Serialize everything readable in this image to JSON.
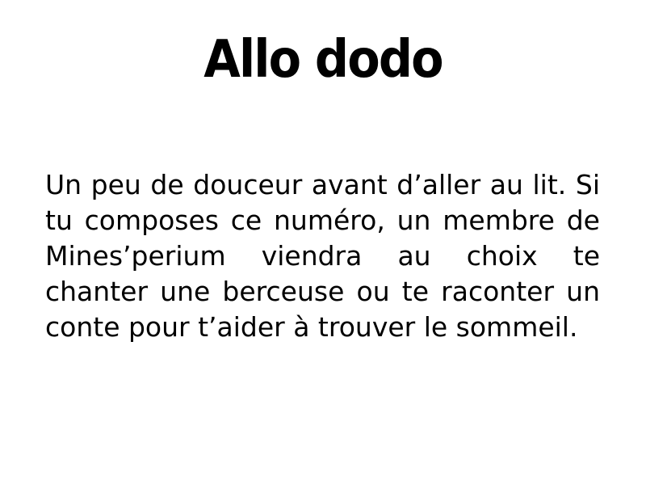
{
  "slide": {
    "title": "Allo dodo",
    "body": "Un peu de douceur avant d’aller au lit. Si tu composes ce numéro, un membre de Mines’perium viendra au choix te chanter une berceuse ou te raconter un conte pour t’aider à trouver le sommeil."
  },
  "colors": {
    "background": "#ffffff",
    "text": "#000000"
  }
}
